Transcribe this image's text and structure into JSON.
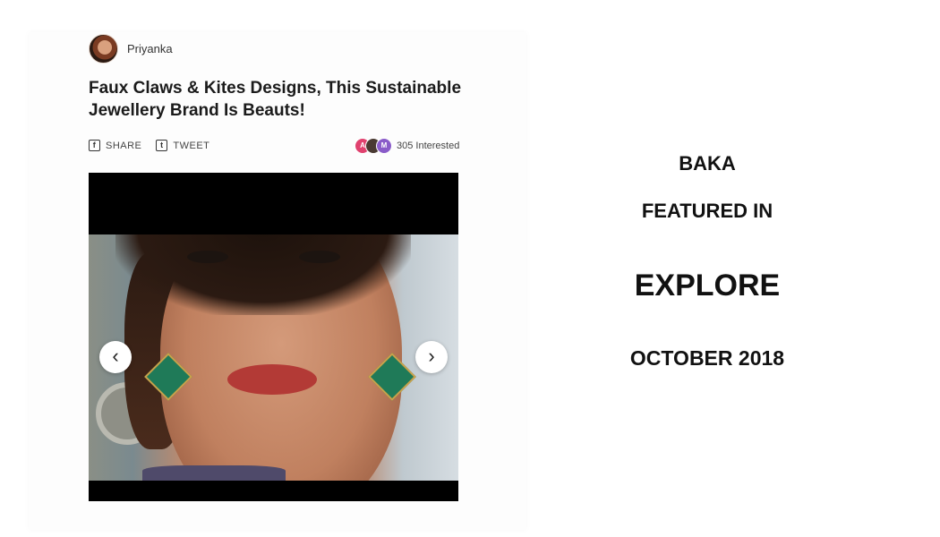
{
  "article": {
    "author": "Priyanka",
    "title": "Faux Claws & Kites Designs, This Sustainable Jewellery Brand Is Beauts!",
    "share_label": "SHARE",
    "tweet_label": "TWEET",
    "interested_avatars": [
      "A",
      "",
      "M"
    ],
    "interested_text": "305 Interested",
    "carousel": {
      "prev_icon": "‹",
      "next_icon": "›"
    }
  },
  "feature": {
    "brand": "BAKA",
    "featured_in": "FEATURED IN",
    "publication": "EXPLORE",
    "date": "OCTOBER 2018"
  },
  "colors": {
    "avatar_a": "#e0426f",
    "avatar_c": "#8a5cc9",
    "text": "#111111"
  }
}
